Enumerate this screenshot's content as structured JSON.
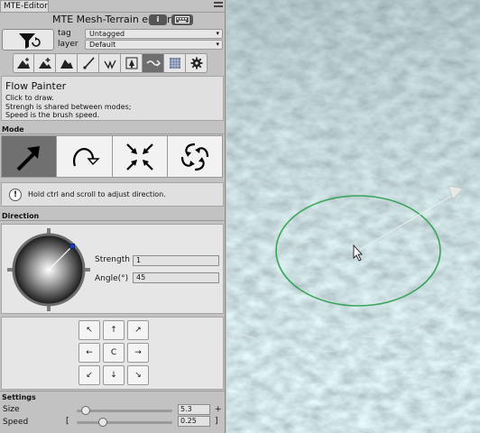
{
  "window": {
    "tab_title": "MTE-Editor"
  },
  "header": {
    "title": "MTE Mesh-Terrain editor",
    "info_glyph": "i"
  },
  "object": {
    "tag_label": "tag",
    "tag_value": "Untagged",
    "layer_label": "layer",
    "layer_value": "Default"
  },
  "toolbar": {
    "icons": [
      "raise-terrain-icon",
      "add-terrain-icon",
      "smooth-terrain-icon",
      "paint-brush-icon",
      "grass-icon",
      "tree-icon",
      "flow-painter-icon",
      "grid-icon",
      "settings-gear-icon"
    ],
    "active_index": 6
  },
  "description": {
    "title": "Flow Painter",
    "line1": "Click to draw.",
    "line2": "Strengh is shared between modes;",
    "line3": "Speed is the brush speed."
  },
  "mode": {
    "heading": "Mode",
    "options": [
      "directional-arrow-icon",
      "rotate-arrow-icon",
      "converge-arrows-icon",
      "vortex-icon"
    ],
    "active_index": 0
  },
  "hint": {
    "glyph": "!",
    "text": "Hold ctrl and scroll to adjust direction."
  },
  "direction": {
    "heading": "Direction",
    "strength_label": "Strength",
    "strength_value": "1",
    "angle_label": "Angle(°)",
    "angle_value": "45",
    "angle_degrees": 45
  },
  "arrows": {
    "labels": [
      "↖",
      "↑",
      "↗",
      "←",
      "C",
      "→",
      "↙",
      "↓",
      "↘"
    ]
  },
  "settings": {
    "heading": "Settings",
    "size_label": "Size",
    "size_value": "5.3",
    "size_cap": "+",
    "size_fraction": 0.05,
    "speed_label": "Speed",
    "speed_value": "0.25",
    "speed_open": "[",
    "speed_close": "]",
    "speed_fraction": 0.25
  },
  "colors": {
    "brush_ring": "#3aa55a",
    "terrain": "#8fb3b6",
    "active_tool": "#6e6e6e"
  }
}
